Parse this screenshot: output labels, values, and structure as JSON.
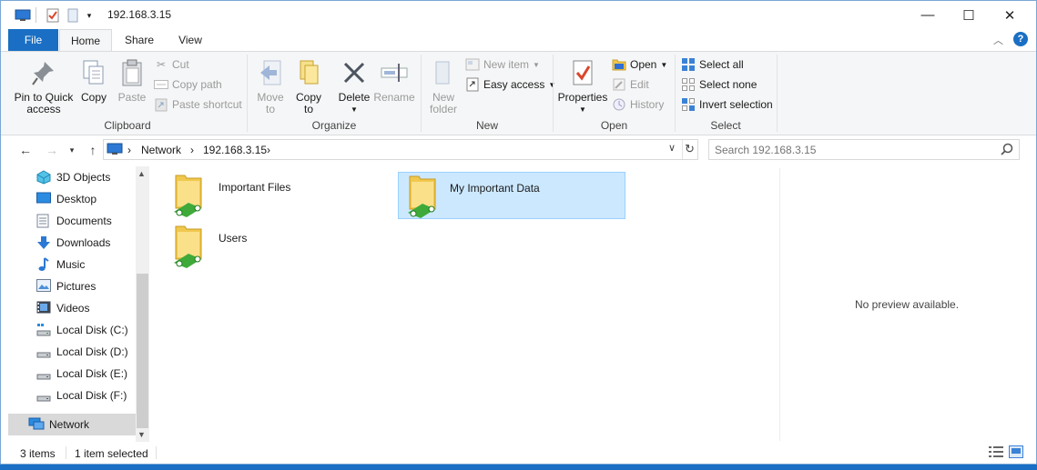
{
  "window": {
    "title": "192.168.3.15",
    "minimize_glyph": "—",
    "maximize_glyph": "☐",
    "close_glyph": "✕"
  },
  "ribbon_tabs": {
    "file": "File",
    "home": "Home",
    "share": "Share",
    "view": "View"
  },
  "clipboard": {
    "label": "Clipboard",
    "pin_line1": "Pin to Quick",
    "pin_line2": "access",
    "copy": "Copy",
    "paste": "Paste",
    "cut": "Cut",
    "copy_path": "Copy path",
    "paste_shortcut": "Paste shortcut"
  },
  "organize": {
    "label": "Organize",
    "move_line1": "Move",
    "move_line2": "to",
    "copy_line1": "Copy",
    "copy_line2": "to",
    "delete": "Delete",
    "rename": "Rename"
  },
  "new_group": {
    "label": "New",
    "new_folder_line1": "New",
    "new_folder_line2": "folder",
    "new_item": "New item",
    "easy_access": "Easy access"
  },
  "open_group": {
    "label": "Open",
    "properties": "Properties",
    "open": "Open",
    "edit": "Edit",
    "history": "History"
  },
  "select_group": {
    "label": "Select",
    "select_all": "Select all",
    "select_none": "Select none",
    "invert_selection": "Invert selection"
  },
  "address": {
    "crumb_network": "Network",
    "crumb_host": "192.168.3.15",
    "separator": "›"
  },
  "search": {
    "placeholder": "Search 192.168.3.15"
  },
  "nav_pane": {
    "items": [
      {
        "label": "3D Objects",
        "icon": "3d-objects-icon"
      },
      {
        "label": "Desktop",
        "icon": "desktop-icon"
      },
      {
        "label": "Documents",
        "icon": "documents-icon"
      },
      {
        "label": "Downloads",
        "icon": "downloads-icon"
      },
      {
        "label": "Music",
        "icon": "music-icon"
      },
      {
        "label": "Pictures",
        "icon": "pictures-icon"
      },
      {
        "label": "Videos",
        "icon": "videos-icon"
      },
      {
        "label": "Local Disk (C:)",
        "icon": "drive-icon"
      },
      {
        "label": "Local Disk (D:)",
        "icon": "drive-icon"
      },
      {
        "label": "Local Disk (E:)",
        "icon": "drive-icon"
      },
      {
        "label": "Local Disk (F:)",
        "icon": "drive-icon"
      }
    ],
    "network": "Network"
  },
  "files": [
    {
      "name": "Important Files",
      "selected": false
    },
    {
      "name": "My Important Data",
      "selected": true
    },
    {
      "name": "Users",
      "selected": false
    }
  ],
  "preview": {
    "text": "No preview available."
  },
  "status": {
    "count": "3 items",
    "selection": "1 item selected"
  },
  "colors": {
    "accent": "#1a6fc4",
    "selection_bg": "#cce8ff",
    "selection_border": "#99d1ff"
  }
}
